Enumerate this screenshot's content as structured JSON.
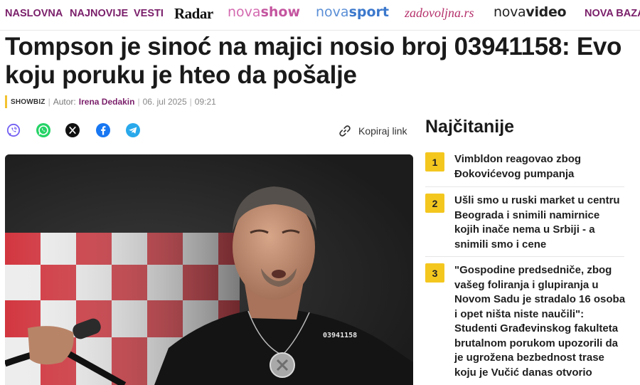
{
  "nav": {
    "items": [
      "NASLOVNA",
      "NAJNOVIJE",
      "VESTI"
    ],
    "brands": {
      "radar": "Radar",
      "show_prefix": "nova",
      "show_suffix": "show",
      "sport_prefix": "nova",
      "sport_suffix": "sport",
      "zadovoljna": "zadovoljna.rs",
      "video_prefix": "nova",
      "video_suffix": "video"
    },
    "last_item": "NOVA BAZA"
  },
  "article": {
    "title": "Tompson je sinoć na majici nosio broj 03941158: Evo koju poruku je hteo da pošalje",
    "category": "SHOWBIZ",
    "author_label": "Autor:",
    "author": "Irena Dedakin",
    "date": "06. jul 2025",
    "time": "09:21",
    "shirt_text": "03941158"
  },
  "share": {
    "icons": [
      "viber-icon",
      "whatsapp-icon",
      "x-icon",
      "facebook-icon",
      "telegram-icon"
    ],
    "copy_label": "Kopiraj link"
  },
  "sidebar": {
    "title": "Najčitanije",
    "items": [
      {
        "rank": "1",
        "text": "Vimbldon reagovao zbog Đokovićevog pumpanja"
      },
      {
        "rank": "2",
        "text": "Ušli smo u ruski market u centru Beograda i snimili namirnice kojih inače nema u Srbiji - a snimili smo i cene"
      },
      {
        "rank": "3",
        "text": "\"Gospodine predsedniče, zbog vašeg foliranja i glupiranja u Novom Sadu je stradalo 16 osoba i opet ništa niste naučili\": Studenti Građevinskog fakulteta brutalnom porukom upozorili da je ugrožena bezbednost trase koju je Vučić danas otvorio"
      }
    ]
  },
  "colors": {
    "nav": "#7a1f6a",
    "badge": "#f4c71f",
    "category_bar": "#f2c230",
    "whatsapp": "#25d366",
    "facebook": "#1877f2",
    "telegram": "#29a9eb",
    "viber": "#7360f2"
  }
}
